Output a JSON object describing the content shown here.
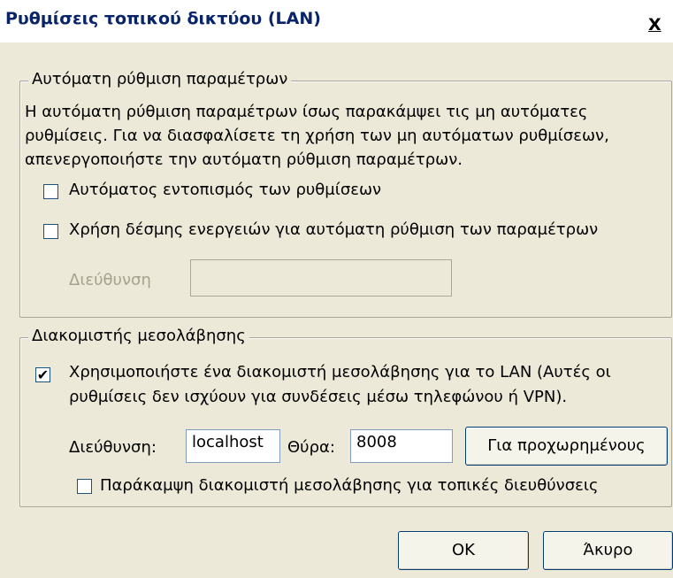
{
  "window": {
    "title": "Ρυθμίσεις τοπικού δικτύου (LAN)",
    "close_label": "X"
  },
  "auto_config": {
    "group_label": "Αυτόματη ρύθμιση παραμέτρων",
    "description": [
      "Η αυτόματη ρύθμιση παραμέτρων ίσως παρακάμψει τις μη αυτόματες",
      "ρυθμίσεις. Για να διασφαλίσετε τη χρήση των μη αυτόματων ρυθμίσεων,",
      "απενεργοποιήστε την αυτόματη ρύθμιση παραμέτρων."
    ],
    "auto_detect_label": "Αυτόματος εντοπισμός των ρυθμίσεων",
    "auto_detect_checked": false,
    "script_label": "Χρήση δέσμης ενεργειών για αυτόματη ρύθμιση των παραμέτρων",
    "script_checked": false,
    "address_label": "Διεύθυνση",
    "address_value": ""
  },
  "proxy": {
    "group_label": "Διακομιστής μεσολάβησης",
    "use_proxy_label_line1": "Χρησιμοποιήστε ένα διακομιστή μεσολάβησης για το LAN (Αυτές οι",
    "use_proxy_label_line2": "ρυθμίσεις δεν ισχύουν για συνδέσεις μέσω τηλεφώνου ή VPN).",
    "use_proxy_checked": true,
    "check_mark": "✔",
    "address_label": "Διεύθυνση:",
    "address_value": "localhost",
    "port_label": "Θύρα:",
    "port_value": "8008",
    "advanced_label": "Για προχωρημένους",
    "bypass_label": "Παράκαμψη διακομιστή μεσολάβησης για τοπικές διευθύνσεις",
    "bypass_checked": false
  },
  "buttons": {
    "ok_label": "OK",
    "cancel_label": "Άκυρο"
  }
}
